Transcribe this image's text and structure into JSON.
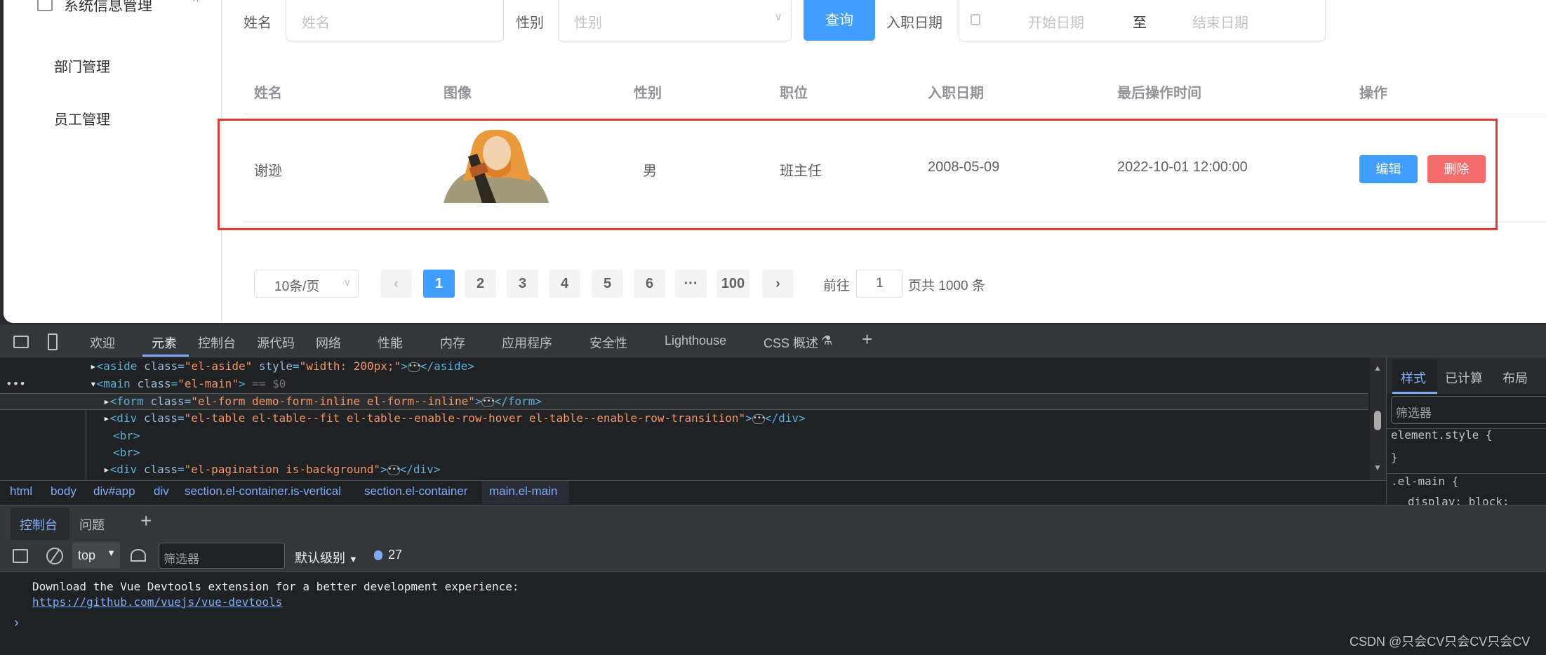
{
  "sidebar": {
    "group": "系统信息管理",
    "items": [
      "部门管理",
      "员工管理"
    ]
  },
  "form": {
    "name_label": "姓名",
    "name_placeholder": "姓名",
    "gender_label": "性别",
    "gender_placeholder": "性别",
    "query": "查询",
    "date_label": "入职日期",
    "start_placeholder": "开始日期",
    "separator": "至",
    "end_placeholder": "结束日期"
  },
  "table": {
    "headers": [
      "姓名",
      "图像",
      "性别",
      "职位",
      "入职日期",
      "最后操作时间",
      "操作"
    ],
    "rows": [
      {
        "name": "谢逊",
        "gender": "男",
        "job": "班主任",
        "entry_date": "2008-05-09",
        "update_time": "2022-10-01 12:00:00",
        "edit": "编辑",
        "delete": "删除"
      }
    ]
  },
  "pagination": {
    "page_size": "10条/页",
    "pages": [
      "1",
      "2",
      "3",
      "4",
      "5",
      "6",
      "···",
      "100"
    ],
    "current": "1",
    "goto_label": "前往",
    "goto_value": "1",
    "total_text": "页共 1000 条"
  },
  "devtools": {
    "tabs": [
      "欢迎",
      "元素",
      "控制台",
      "源代码",
      "网络",
      "性能",
      "内存",
      "应用程序",
      "安全性",
      "Lighthouse",
      "CSS 概述"
    ],
    "active_tab": "元素",
    "dom": {
      "aside_style": "width: 200px;",
      "main_marker": "== $0",
      "form_class": "el-form demo-form-inline el-form--inline",
      "table_class": "el-table el-table--fit el-table--enable-row-hover el-table--enable-row-transition",
      "pagination_class": "el-pagination is-background"
    },
    "breadcrumb": [
      "html",
      "body",
      "div#app",
      "div",
      "section.el-container.is-vertical",
      "section.el-container",
      "main.el-main"
    ],
    "styles_tabs": [
      "样式",
      "已计算",
      "布局"
    ],
    "styles_filter": "筛选器",
    "styles_rules": [
      "element.style {",
      "}",
      ".el-main {",
      "display: block;"
    ],
    "drawer_tabs": [
      "控制台",
      "问题"
    ],
    "context": "top",
    "filter_placeholder": "筛选器",
    "level": "默认级别",
    "message_count": "27",
    "console_message": "Download the Vue Devtools extension for a better development experience:",
    "console_link": "https://github.com/vuejs/vue-devtools"
  },
  "watermark": "CSDN @只会CV只会CV只会CV",
  "colors": {
    "primary": "#409eff",
    "danger": "#f56c6c",
    "highlight": "#e53935"
  }
}
